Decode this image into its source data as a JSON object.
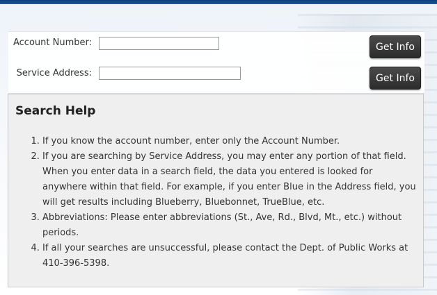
{
  "form": {
    "account": {
      "label": "Account Number:",
      "value": "",
      "button": "Get Info"
    },
    "address": {
      "label": "Service Address:",
      "value": "",
      "button": "Get Info"
    }
  },
  "help": {
    "title": "Search Help",
    "items": [
      "If you know the account number, enter only the Account Number.",
      "If you are searching by Service Address, you may enter any portion of that field. When you enter data in a search field, the data you entered is looked for anywhere within that field. For example, if you enter Blue in the Address field, you will get results including Blueberry, Bluebonnet, TrueBlue, etc.",
      "Abbreviations: Please enter abbreviations (St., Ave, Rd., Blvd, Mt., etc.) without periods.",
      "If all your searches are unsuccessful, please contact the Dept. of Public Works at 410-396-5398."
    ]
  }
}
